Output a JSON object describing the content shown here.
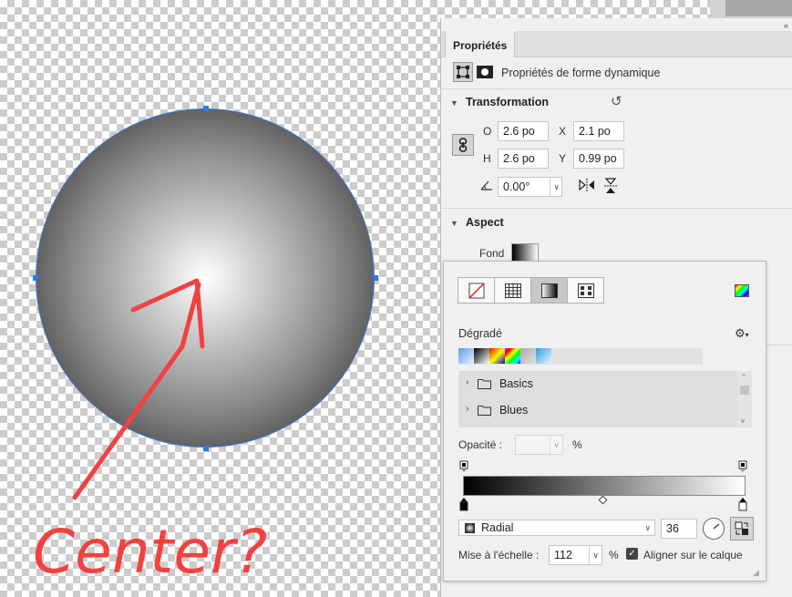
{
  "canvas": {
    "annotation_text": "Center?"
  },
  "panel": {
    "tab_label": "Propriétés",
    "shape_header": "Propriétés de forme dynamique",
    "transformation": {
      "title": "Transformation",
      "w_label": "O",
      "w_value": "2.6 po",
      "x_label": "X",
      "x_value": "2.1 po",
      "h_label": "H",
      "h_value": "2.6 po",
      "y_label": "Y",
      "y_value": "0.99 po",
      "angle_value": "0.00°"
    },
    "aspect": {
      "title": "Aspect",
      "fill_label": "Fond"
    }
  },
  "gradient_popup": {
    "section_label": "Dégradé",
    "folders": [
      {
        "label": "Basics"
      },
      {
        "label": "Blues"
      }
    ],
    "opacity_label": "Opacité :",
    "opacity_value": "",
    "opacity_unit": "%",
    "type_value": "Radial",
    "angle_value": "36",
    "scale_label": "Mise à l'échelle :",
    "scale_value": "112",
    "scale_unit": "%",
    "align_label": "Aligner sur le calque",
    "align_checked": true
  },
  "colors": {
    "selection_blue": "#2a7be6",
    "annotation_red": "#f24141",
    "panel_bg": "#f0f0f0"
  }
}
